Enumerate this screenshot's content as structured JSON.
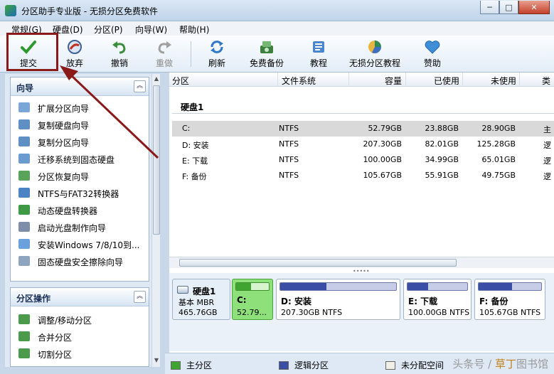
{
  "window": {
    "title": "分区助手专业版 - 无损分区免费软件",
    "minimize": "─",
    "maximize": "□",
    "close": "✕"
  },
  "menu": [
    "常规(G)",
    "硬盘(D)",
    "分区(P)",
    "向导(W)",
    "帮助(H)"
  ],
  "toolbar": [
    {
      "label": "提交",
      "icon": "checkmark-icon",
      "enabled": true
    },
    {
      "label": "放弃",
      "icon": "discard-icon",
      "enabled": true
    },
    {
      "label": "撤销",
      "icon": "undo-icon",
      "enabled": true
    },
    {
      "label": "重做",
      "icon": "redo-icon",
      "enabled": false
    },
    {
      "label": "刷新",
      "icon": "refresh-icon",
      "enabled": true
    },
    {
      "label": "免费备份",
      "icon": "backup-icon",
      "enabled": true
    },
    {
      "label": "教程",
      "icon": "tutorial-icon",
      "enabled": true
    },
    {
      "label": "无损分区教程",
      "icon": "partition-tutorial-icon",
      "enabled": true
    },
    {
      "label": "赞助",
      "icon": "heart-icon",
      "enabled": true
    }
  ],
  "wizard": {
    "title": "向导",
    "items": [
      "扩展分区向导",
      "复制硬盘向导",
      "复制分区向导",
      "迁移系统到固态硬盘",
      "分区恢复向导",
      "NTFS与FAT32转换器",
      "动态硬盘转换器",
      "启动光盘制作向导",
      "安装Windows 7/8/10到...",
      "固态硬盘安全擦除向导"
    ]
  },
  "partition_ops": {
    "title": "分区操作",
    "items": [
      "调整/移动分区",
      "合并分区",
      "切割分区"
    ]
  },
  "table": {
    "columns": [
      "分区",
      "文件系统",
      "容量",
      "已使用",
      "未使用",
      "类"
    ],
    "disk_label": "硬盘1",
    "rows": [
      {
        "name": "C:",
        "fs": "NTFS",
        "capacity": "52.79GB",
        "used": "23.88GB",
        "free": "28.90GB",
        "type": "主"
      },
      {
        "name": "D: 安装",
        "fs": "NTFS",
        "capacity": "207.30GB",
        "used": "82.01GB",
        "free": "125.28GB",
        "type": "逻"
      },
      {
        "name": "E: 下载",
        "fs": "NTFS",
        "capacity": "100.00GB",
        "used": "34.99GB",
        "free": "65.01GB",
        "type": "逻"
      },
      {
        "name": "F: 备份",
        "fs": "NTFS",
        "capacity": "105.67GB",
        "used": "55.91GB",
        "free": "49.75GB",
        "type": "逻"
      }
    ]
  },
  "diskmap": {
    "disk": {
      "name": "硬盘1",
      "type": "基本 MBR",
      "size": "465.76GB"
    },
    "partitions": [
      {
        "name": "C:",
        "info": "52.79...",
        "used_fraction": 0.45
      },
      {
        "name": "D: 安装",
        "info": "207.30GB NTFS",
        "used_fraction": 0.4
      },
      {
        "name": "E: 下载",
        "info": "100.00GB NTFS",
        "used_fraction": 0.35
      },
      {
        "name": "F: 备份",
        "info": "105.67GB NTFS",
        "used_fraction": 0.53
      }
    ]
  },
  "legend": [
    "主分区",
    "逻辑分区",
    "未分配空间"
  ],
  "watermark": {
    "part1": "头条号 / ",
    "part2": "草丁",
    "part3": "图书馆"
  },
  "colors": {
    "primary": "#3fa530",
    "logical": "#3b4ea5",
    "unallocated": "#f2f0e6",
    "annotation": "#8a1a1a"
  }
}
